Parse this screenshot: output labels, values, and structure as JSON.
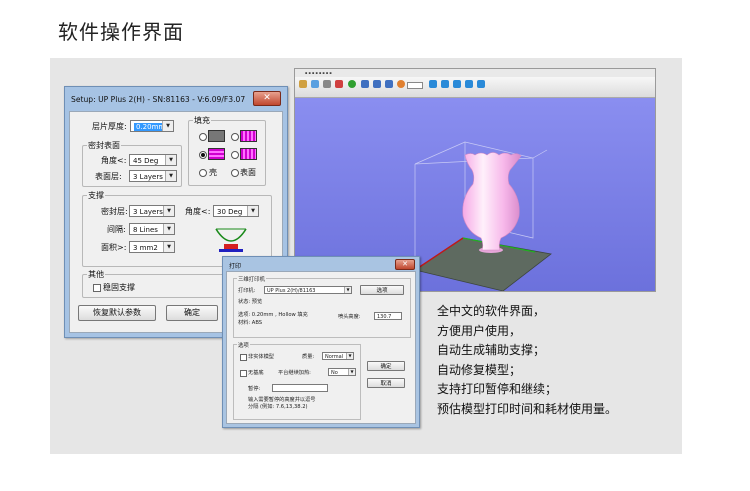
{
  "heading": "软件操作界面",
  "setup_dialog": {
    "title": "Setup: UP Plus 2(H) - SN:81163 - V:6.09/F3.07",
    "close": "✕",
    "layer_thickness_label": "层片厚度:",
    "layer_thickness_value": "0.20mm",
    "seal_surface": {
      "group_label": "密封表面",
      "angle_label": "角度<:",
      "angle_value": "45 Deg",
      "surface_label": "表面层:",
      "surface_value": "3 Layers"
    },
    "fill": {
      "group_label": "填充",
      "shell_label": "壳",
      "surface_label": "表面"
    },
    "support": {
      "group_label": "支撑",
      "seal_label": "密封层:",
      "seal_value": "3 Layers",
      "angle_label": "角度<:",
      "angle_value": "30 Deg",
      "spacing_label": "间隔:",
      "spacing_value": "8 Lines",
      "area_label": "面积>:",
      "area_value": "3 mm2"
    },
    "other": {
      "group_label": "其他",
      "stable_support_label": "稳固支撑"
    },
    "restore_button": "恢复默认参数",
    "ok_button": "确定"
  },
  "print_dialog": {
    "title": "打印",
    "close": "✕",
    "printer_group": "三维打印机",
    "printer_label": "打印机:",
    "printer_value": "UP Plus 2(H)/81163",
    "select_button": "选项",
    "status": "状态: 预览",
    "options_line": "选项: 0.20mm , Hollow 填充",
    "material_line": "材料: ABS",
    "nozzle_label": "喷头高度:",
    "nozzle_value": "130.7",
    "options_group": "选项",
    "non_solid_label": "非实体模型",
    "quality_label": "质量:",
    "quality_value": "Normal",
    "no_raft_label": "无基底",
    "platform_heat_label": "平台继续加热:",
    "platform_heat_value": "No",
    "pause_label": "暂停:",
    "hint_line1": "输入需要暂停的高度并以逗号",
    "hint_line2": "分隔 (例如: 7.6,13,38.2)",
    "ok_button": "确定",
    "cancel_button": "取消"
  },
  "features": [
    "全中文的软件界面，",
    "方便用户使用，",
    "自动生成辅助支撑；",
    "自动修复模型；",
    "支持打印暂停和继续；",
    "预估模型打印时间和耗材使用量。"
  ],
  "colors": {
    "fill_pattern": "#d000d0",
    "vase": "#f3b8e8",
    "viewport_bg": "#7a7fe6",
    "platform": "#5e6a60"
  }
}
